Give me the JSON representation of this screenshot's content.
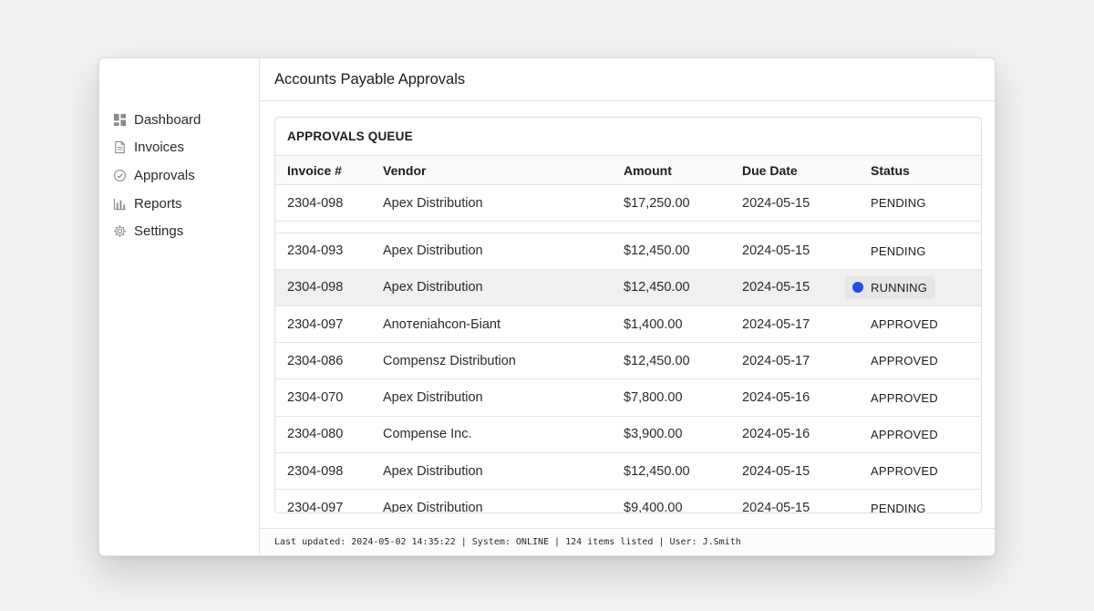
{
  "sidebar": {
    "items": [
      {
        "label": "Dashboard",
        "icon": "dashboard-icon"
      },
      {
        "label": "Invoices",
        "icon": "document-icon"
      },
      {
        "label": "Approvals",
        "icon": "check-circle-icon"
      },
      {
        "label": "Reports",
        "icon": "bar-chart-icon"
      },
      {
        "label": "Settings",
        "icon": "gear-icon"
      }
    ]
  },
  "header": {
    "title": "Accounts Payable Approvals"
  },
  "panel": {
    "title": "APPROVALS QUEUE"
  },
  "table": {
    "columns": [
      "Invoice #",
      "Vendor",
      "Amount",
      "Due Date",
      "Status"
    ],
    "rows": [
      {
        "invoice": "2304-098",
        "vendor": "Apex Distribution",
        "amount": "$17,250.00",
        "due": "2024-05-15",
        "status": "PENDING"
      },
      {
        "invoice": "2304-093",
        "vendor": "Apex Distribution",
        "amount": "$12,450.00",
        "due": "2024-05-15",
        "status": "PENDING"
      },
      {
        "invoice": "2304-098",
        "vendor": "Apex Distribution",
        "amount": "$12,450.00",
        "due": "2024-05-15",
        "status": "RUNNING"
      },
      {
        "invoice": "2304-097",
        "vendor": "Anoтeniahcon-Бiant",
        "amount": "$1,400.00",
        "due": "2024-05-17",
        "status": "APPROVED"
      },
      {
        "invoice": "2304-086",
        "vendor": "Compensz Distribution",
        "amount": "$12,450.00",
        "due": "2024-05-17",
        "status": "APPROVED"
      },
      {
        "invoice": "2304-070",
        "vendor": "Apex Distribution",
        "amount": "$7,800.00",
        "due": "2024-05-16",
        "status": "APPROVED"
      },
      {
        "invoice": "2304-080",
        "vendor": "Compense Inc.",
        "amount": "$3,900.00",
        "due": "2024-05-16",
        "status": "APPROVED"
      },
      {
        "invoice": "2304-098",
        "vendor": "Apex Distribution",
        "amount": "$12,450.00",
        "due": "2024-05-15",
        "status": "APPROVED"
      },
      {
        "invoice": "2304-097",
        "vendor": "Apex Distribution",
        "amount": "$9,400.00",
        "due": "2024-05-15",
        "status": "PENDING"
      }
    ]
  },
  "statusbar": {
    "text": "Last updated: 2024-05-02 14:35:22 | System: ONLINE | 124 items listed | User: J.Smith"
  },
  "colors": {
    "running_dot": "#1f4fe8",
    "selected_row": "#f0f0f1"
  }
}
